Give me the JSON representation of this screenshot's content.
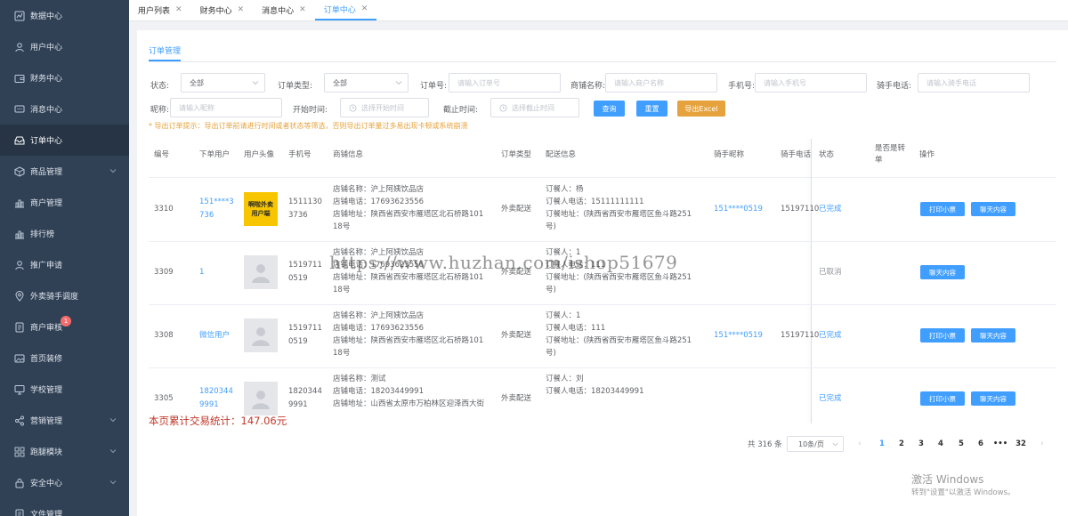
{
  "sidebar": {
    "items": [
      {
        "label": "数据中心",
        "icon": "dashboard-icon"
      },
      {
        "label": "用户中心",
        "icon": "user-icon"
      },
      {
        "label": "财务中心",
        "icon": "wallet-icon"
      },
      {
        "label": "消息中心",
        "icon": "message-icon"
      },
      {
        "label": "订单中心",
        "icon": "inbox-icon"
      },
      {
        "label": "商品管理",
        "icon": "box-icon"
      },
      {
        "label": "商户管理",
        "icon": "chart-icon"
      },
      {
        "label": "排行榜",
        "icon": "chart-icon"
      },
      {
        "label": "推广申请",
        "icon": "user-icon"
      },
      {
        "label": "外卖骑手调度",
        "icon": "location-icon"
      },
      {
        "label": "商户审核",
        "icon": "document-icon",
        "badge": "1"
      },
      {
        "label": "首页装修",
        "icon": "picture-icon"
      },
      {
        "label": "学校管理",
        "icon": "monitor-icon"
      },
      {
        "label": "营销管理",
        "icon": "share-icon"
      },
      {
        "label": "跑腿模块",
        "icon": "grid-icon"
      },
      {
        "label": "安全中心",
        "icon": "lock-icon"
      },
      {
        "label": "文件管理",
        "icon": "document-icon"
      }
    ]
  },
  "tabs": [
    {
      "label": "用户列表"
    },
    {
      "label": "财务中心"
    },
    {
      "label": "消息中心"
    },
    {
      "label": "订单中心"
    }
  ],
  "subtab": "订单管理",
  "filters": {
    "status_label": "状态:",
    "status_value": "全部",
    "type_label": "订单类型:",
    "type_value": "全部",
    "order_no_label": "订单号:",
    "order_no_placeholder": "请输入订单号",
    "shop_label": "商铺名称:",
    "shop_placeholder": "请输入商户名称",
    "phone_label": "手机号:",
    "phone_placeholder": "请输入手机号",
    "rider_phone_label": "骑手电话:",
    "rider_phone_placeholder": "请输入骑手电话",
    "nick_label": "昵称:",
    "nick_placeholder": "请输入昵称",
    "start_label": "开始时间:",
    "start_placeholder": "选择开始时间",
    "end_label": "截止时间:",
    "end_placeholder": "选择截止时间",
    "search_btn": "查询",
    "reset_btn": "重置",
    "export_btn": "导出Excel"
  },
  "tip": "* 导出订单提示：导出订单前请进行时间或者状态等筛选，否则导出订单量过多易出现卡顿或系统崩溃",
  "table": {
    "headers": {
      "id": "编号",
      "user": "下单用户",
      "avatar": "用户头像",
      "phone": "手机号",
      "shop": "商铺信息",
      "type": "订单类型",
      "delivery": "配送信息",
      "rider": "骑手昵称",
      "rider_phone": "骑手电话",
      "status": "状态",
      "transfer1": "是否是转",
      "transfer2": "单",
      "ops": "操作"
    },
    "rows": [
      {
        "id": "3310",
        "user1": "151****3",
        "user2": "736",
        "avatar": "brand",
        "avatar_text1": "啊啦外卖",
        "avatar_text2": "用户端",
        "phone1": "1511130",
        "phone2": "3736",
        "shop1": "店铺名称：沪上阿姨饮品店",
        "shop2": "店铺电话：17693623556",
        "shop3": "店铺地址：陕西省西安市雁塔区北石桥路101",
        "shop4": "18号",
        "type": "外卖配送",
        "del1": "订餐人：杨",
        "del2": "订餐人电话：15111111111",
        "del3": "订餐地址：(陕西省西安市雁塔区鱼斗路251",
        "del4": "号)",
        "rider": "151****0519",
        "rider_phone": "15197110",
        "status": "已完成",
        "btn1": "打印小票",
        "btn2": "聊天内容"
      },
      {
        "id": "3309",
        "user1": "1",
        "user2": "",
        "avatar": "default",
        "phone1": "1519711",
        "phone2": "0519",
        "shop1": "店铺名称：沪上阿姨饮品店",
        "shop2": "店铺电话：17693623556",
        "shop3": "店铺地址：陕西省西安市雁塔区北石桥路101",
        "shop4": "18号",
        "type": "外卖配送",
        "del1": "订餐人：1",
        "del2": "订餐人电话：111",
        "del3": "订餐地址：(陕西省西安市雁塔区鱼斗路251",
        "del4": "号)",
        "rider": "",
        "rider_phone": "",
        "status": "已取消",
        "btn1": "",
        "btn2": "聊天内容"
      },
      {
        "id": "3308",
        "user1": "微信用户",
        "user2": "",
        "avatar": "default",
        "phone1": "1519711",
        "phone2": "0519",
        "shop1": "店铺名称：沪上阿姨饮品店",
        "shop2": "店铺电话：17693623556",
        "shop3": "店铺地址：陕西省西安市雁塔区北石桥路101",
        "shop4": "18号",
        "type": "外卖配送",
        "del1": "订餐人：1",
        "del2": "订餐人电话：111",
        "del3": "订餐地址：(陕西省西安市雁塔区鱼斗路251",
        "del4": "号)",
        "rider": "151****0519",
        "rider_phone": "15197110",
        "status": "已完成",
        "btn1": "打印小票",
        "btn2": "聊天内容"
      },
      {
        "id": "3305",
        "user1": "1820344",
        "user2": "9991",
        "avatar": "default",
        "phone1": "1820344",
        "phone2": "9991",
        "shop1": "店铺名称：测试",
        "shop2": "店铺电话：18203449991",
        "shop3": "店铺地址：山西省太原市万柏林区迎泽西大街",
        "shop4": "",
        "type": "外卖配送",
        "del1": "订餐人：刘",
        "del2": "订餐人电话：18203449991",
        "del3": "",
        "del4": "",
        "rider": "",
        "rider_phone": "",
        "status": "已完成",
        "btn1": "打印小票",
        "btn2": "聊天内容"
      }
    ]
  },
  "total_text": "本页累计交易统计：147.06元",
  "pagination": {
    "total": "共 316 条",
    "size": "10条/页",
    "prev": "‹",
    "next": "›",
    "pages": [
      "1",
      "2",
      "3",
      "4",
      "5",
      "6",
      "•••",
      "32"
    ],
    "current": "1"
  },
  "watermark": "https://www.huzhan.com/ishop51679",
  "windows_activation": {
    "line1": "激活 Windows",
    "line2": "转到\"设置\"以激活 Windows。"
  }
}
